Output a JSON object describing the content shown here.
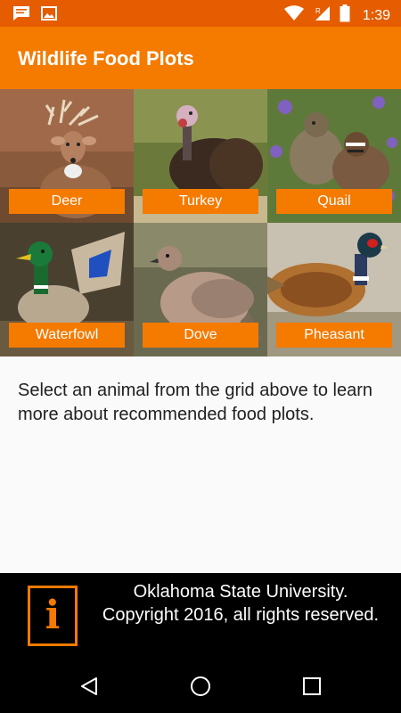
{
  "status_bar": {
    "time": "1:39",
    "icons": [
      "message-icon",
      "image-icon",
      "wifi-icon",
      "signal-icon",
      "battery-icon"
    ]
  },
  "app_bar": {
    "title": "Wildlife Food Plots"
  },
  "grid": {
    "items": [
      {
        "label": "Deer"
      },
      {
        "label": "Turkey"
      },
      {
        "label": "Quail"
      },
      {
        "label": "Waterfowl"
      },
      {
        "label": "Dove"
      },
      {
        "label": "Pheasant"
      }
    ]
  },
  "content": {
    "instruction": "Select an animal from the grid above to learn more about recommended food plots."
  },
  "footer": {
    "logo_letter": "i",
    "line1": "Oklahoma State University.",
    "line2": "Copyright 2016, all rights reserved."
  },
  "colors": {
    "status_bar": "#e65c00",
    "app_bar": "#f47a00",
    "label_bg": "#f47a00",
    "footer_bg": "#000000"
  }
}
